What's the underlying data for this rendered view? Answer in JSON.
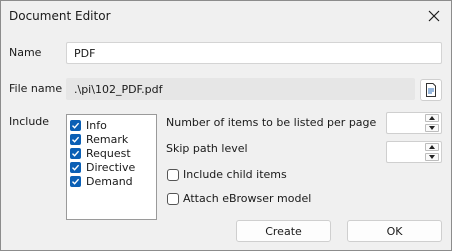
{
  "window": {
    "title": "Document Editor"
  },
  "fields": {
    "name_label": "Name",
    "name_value": "PDF",
    "filename_label": "File name",
    "filename_value": ".\\pi\\102_PDF.pdf",
    "include_label": "Include"
  },
  "include_items": [
    {
      "label": "Info",
      "checked": true
    },
    {
      "label": "Remark",
      "checked": true
    },
    {
      "label": "Request",
      "checked": true
    },
    {
      "label": "Directive",
      "checked": true
    },
    {
      "label": "Demand",
      "checked": true
    }
  ],
  "options": {
    "items_per_page_label": "Number of items to be listed per page",
    "items_per_page_value": "",
    "skip_path_label": "Skip path level",
    "skip_path_value": "",
    "include_children_label": "Include child items",
    "include_children_checked": false,
    "attach_ebrowser_label": "Attach eBrowser model",
    "attach_ebrowser_checked": false
  },
  "buttons": {
    "create": "Create",
    "ok": "OK"
  },
  "icons": {
    "close": "close-icon",
    "browse": "document-icon"
  }
}
